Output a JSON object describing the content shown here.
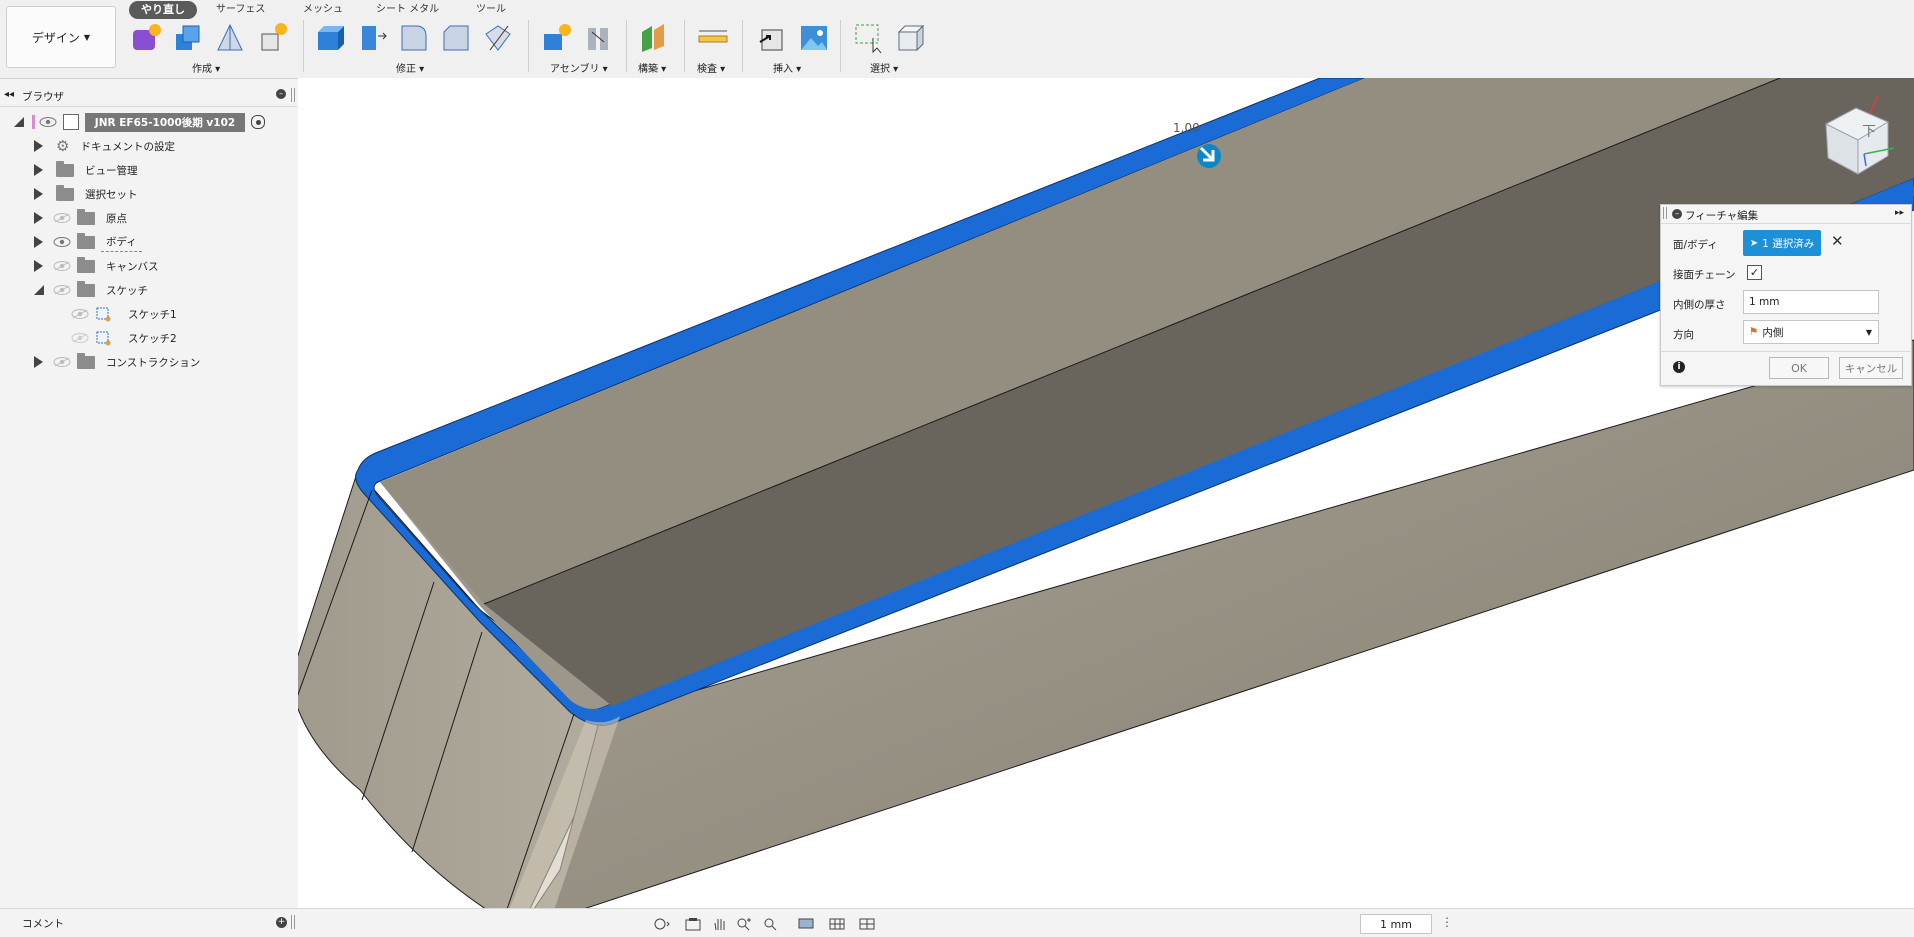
{
  "toolbar": {
    "design_label": "デザイン",
    "tabs": [
      {
        "label": "やり直し"
      },
      {
        "label": "サーフェス"
      },
      {
        "label": "メッシュ"
      },
      {
        "label": "シート メタル"
      },
      {
        "label": "ツール"
      }
    ],
    "groups": [
      {
        "label": "作成"
      },
      {
        "label": "修正"
      },
      {
        "label": "アセンブリ"
      },
      {
        "label": "構築"
      },
      {
        "label": "検査"
      },
      {
        "label": "挿入"
      },
      {
        "label": "選択"
      }
    ]
  },
  "browser": {
    "title": "ブラウザ",
    "root_label": "JNR EF65-1000後期 v102",
    "items": [
      {
        "label": "ドキュメントの設定"
      },
      {
        "label": "ビュー管理"
      },
      {
        "label": "選択セット"
      },
      {
        "label": "原点"
      },
      {
        "label": "ボディ"
      },
      {
        "label": "キャンバス"
      },
      {
        "label": "スケッチ"
      },
      {
        "label": "スケッチ1"
      },
      {
        "label": "スケッチ2"
      },
      {
        "label": "コンストラクション"
      }
    ]
  },
  "viewport": {
    "dimension_label": "1.00",
    "viewcube_label": "下"
  },
  "dialog": {
    "title": "フィーチャ編集",
    "face_body_label": "面/ボディ",
    "selected_label": "1 選択済み",
    "tangent_chain_label": "接面チェーン",
    "tangent_chain_checked": true,
    "inner_thickness_label": "内側の厚さ",
    "inner_thickness_value": "1 mm",
    "direction_label": "方向",
    "direction_value": "内側",
    "ok_label": "OK",
    "cancel_label": "キャンセル"
  },
  "bottom": {
    "comment_label": "コメント",
    "measure_value": "1 mm"
  },
  "colors": {
    "selection_blue": "#1a6bd6",
    "body_tan": "#8f897d",
    "dialog_button_blue": "#1e90d8"
  }
}
